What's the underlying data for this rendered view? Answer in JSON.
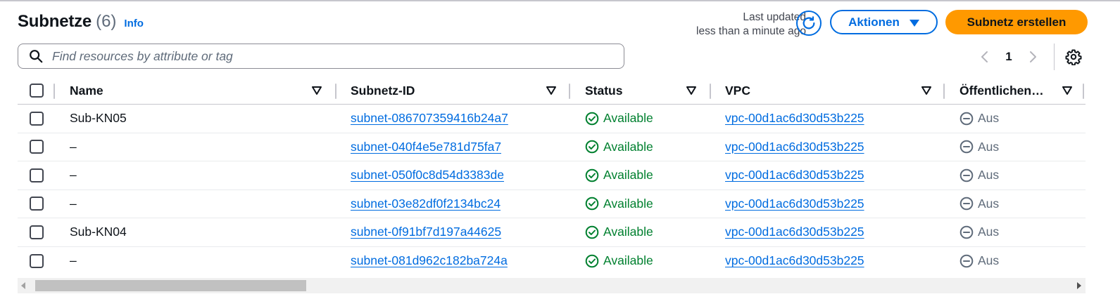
{
  "header": {
    "title": "Subnetze",
    "count": "(6)",
    "info_label": "Info",
    "last_updated_line1": "Last updated",
    "last_updated_line2": "less than a minute ago",
    "refresh_icon": "refresh-icon",
    "actions_label": "Aktionen",
    "create_label": "Subnetz erstellen"
  },
  "search": {
    "placeholder": "Find resources by attribute or tag",
    "value": ""
  },
  "pagination": {
    "current_page": "1"
  },
  "table": {
    "columns": [
      "Name",
      "Subnetz-ID",
      "Status",
      "VPC",
      "Öffentlichen…"
    ],
    "rows": [
      {
        "name": "Sub-KN05",
        "subnet_id": "subnet-086707359416b24a7",
        "status": "Available",
        "vpc": "vpc-00d1ac6d30d53b225",
        "public": "Aus"
      },
      {
        "name": "–",
        "subnet_id": "subnet-040f4e5e781d75fa7",
        "status": "Available",
        "vpc": "vpc-00d1ac6d30d53b225",
        "public": "Aus"
      },
      {
        "name": "–",
        "subnet_id": "subnet-050f0c8d54d3383de",
        "status": "Available",
        "vpc": "vpc-00d1ac6d30d53b225",
        "public": "Aus"
      },
      {
        "name": "–",
        "subnet_id": "subnet-03e82df0f2134bc24",
        "status": "Available",
        "vpc": "vpc-00d1ac6d30d53b225",
        "public": "Aus"
      },
      {
        "name": "Sub-KN04",
        "subnet_id": "subnet-0f91bf7d197a44625",
        "status": "Available",
        "vpc": "vpc-00d1ac6d30d53b225",
        "public": "Aus"
      },
      {
        "name": "–",
        "subnet_id": "subnet-081d962c182ba724a",
        "status": "Available",
        "vpc": "vpc-00d1ac6d30d53b225",
        "public": "Aus"
      }
    ]
  },
  "colors": {
    "link": "#006ce0",
    "primary_button": "#ff9900",
    "status_available": "#00802f",
    "status_off": "#5f6b7a"
  }
}
